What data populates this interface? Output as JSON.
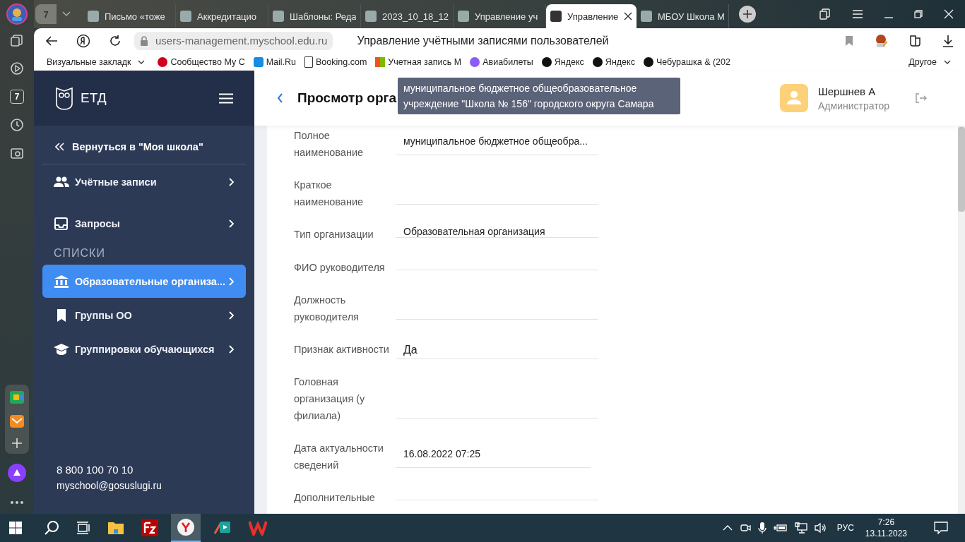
{
  "browser": {
    "tab_counter": "7",
    "tabs": [
      {
        "title": "Письмо «тоже",
        "selected": false
      },
      {
        "title": "Аккредитацио",
        "selected": false
      },
      {
        "title": "Шаблоны: Реда",
        "selected": false
      },
      {
        "title": "2023_10_18_12",
        "selected": false
      },
      {
        "title": "Управление уч",
        "selected": false
      },
      {
        "title": "Управление",
        "selected": true
      },
      {
        "title": "МБОУ Школа М",
        "selected": false
      }
    ],
    "url": "users-management.myschool.edu.ru",
    "page_title": "Управление учётными записями пользователей",
    "bookmarks": [
      "Визуальные закладк",
      "Сообщество My С",
      "Mail.Ru",
      "Booking.com",
      "Учетная запись М",
      "Авиабилеты",
      "Яндекс",
      "Яндекс",
      "Чебурашка & (202"
    ],
    "other_bookmarks": "Другое",
    "sidebar_badge": "7"
  },
  "app": {
    "logo": "ЕТД",
    "back_link": "Вернуться в \"Моя школа\"",
    "nav": [
      {
        "kind": "item",
        "label": "Учётные записи",
        "selected": false
      },
      {
        "kind": "item",
        "label": "Запросы",
        "selected": false
      },
      {
        "kind": "section",
        "label": "СПИСКИ"
      },
      {
        "kind": "item",
        "label": "Образовательные организа...",
        "selected": true
      },
      {
        "kind": "item",
        "label": "Группы ОО",
        "selected": false
      },
      {
        "kind": "item",
        "label": "Группировки обучающихся",
        "selected": false
      }
    ],
    "phone": "8 800 100 70 10",
    "email": "myschool@gosuslugi.ru"
  },
  "header": {
    "title": "Просмотр орга",
    "user_name": "Шершнев А",
    "user_role": "Администратор"
  },
  "tooltip": "муниципальное бюджетное общеобразовательное учреждение \"Школа № 156\" городского округа Самара",
  "fields": [
    {
      "label": "Полное наименование",
      "value": "муниципальное бюджетное общеобра..."
    },
    {
      "label": "Краткое наименование"
    },
    {
      "label": "Тип организации",
      "value": "Образовательная организация"
    },
    {
      "label": "ФИО руководителя"
    },
    {
      "label": "Должность руководителя"
    },
    {
      "label": "Признак активности",
      "value": "Да"
    },
    {
      "label": "Головная организация (у филиала)"
    },
    {
      "label": "Дата актуальности сведений",
      "value": "16.08.2022 07:25"
    },
    {
      "label": "Дополнительные"
    }
  ],
  "taskbar": {
    "language": "РУС",
    "time": "7:26",
    "date": "13.11.2023"
  }
}
